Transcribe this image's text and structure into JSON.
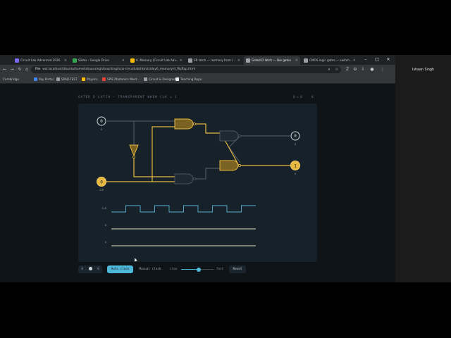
{
  "browser": {
    "tabs": [
      {
        "label": "Circuit Lab Advanced 2026",
        "color": "#7b68ee",
        "active": false
      },
      {
        "label": "Slides - Google Drive",
        "color": "#34a853",
        "active": false
      },
      {
        "label": "6. Memory (Circuit Lab Adv...",
        "color": "#fbbc04",
        "active": false
      },
      {
        "label": "SR latch — memory from l...",
        "color": "#9aa0a6",
        "active": false
      },
      {
        "label": "Gated D latch — like gates",
        "color": "#9aa0a6",
        "active": true
      },
      {
        "label": "CMOS logic gates — switch...",
        "color": "#9aa0a6",
        "active": false
      }
    ],
    "url_prefix": "File",
    "url": "wsl.localhost/Ubuntu/home/ishaansingh/teaching/ncio-circuitlab/html/s/day6_memory/d_flipflop.html",
    "bookmarks": [
      "Cambridge",
      "Pay Portal",
      "SPAD-TEST",
      "Physics",
      "SPIE Photonics West...",
      "Circuit & Designer",
      "Teaching Repo"
    ],
    "bookmark_colors": [
      "#9aa0a6",
      "#4285f4",
      "#9aa0a6",
      "#fbbc04",
      "#ea4335",
      "#9aa0a6",
      "#e8eaed"
    ]
  },
  "sim": {
    "title": "GATED D LATCH — TRANSPARENT WHEN CLK = 1",
    "state": "Q = 0",
    "state_extra": "0",
    "inputs": {
      "d_value": "0",
      "d_label": "D",
      "clk_value": "0",
      "clk_label": "CLK"
    },
    "outputs": {
      "qbar_value": "0",
      "qbar_label": "Q̄",
      "q_value": "1",
      "q_label": "Q"
    },
    "waveforms": [
      {
        "label": "CLK",
        "levels": [
          0,
          1,
          0,
          1,
          0,
          1,
          0,
          1,
          0,
          1
        ]
      },
      {
        "label": "D",
        "levels": [
          0
        ]
      },
      {
        "label": "Q",
        "levels": [
          0
        ]
      }
    ],
    "colors": {
      "wire_on": "#e6b840",
      "wire_off": "#4a5560",
      "wave": "#5ab3d4",
      "panel": "#172129"
    }
  },
  "controls": {
    "toggle_left": "0",
    "toggle_right": "0",
    "auto_clock": "Auto clock",
    "manual_clock": "Manual clock",
    "slow": "slow",
    "fast": "fast",
    "reset": "Reset",
    "speed": 0.55
  },
  "user": {
    "name": "Ishaan Singh"
  }
}
